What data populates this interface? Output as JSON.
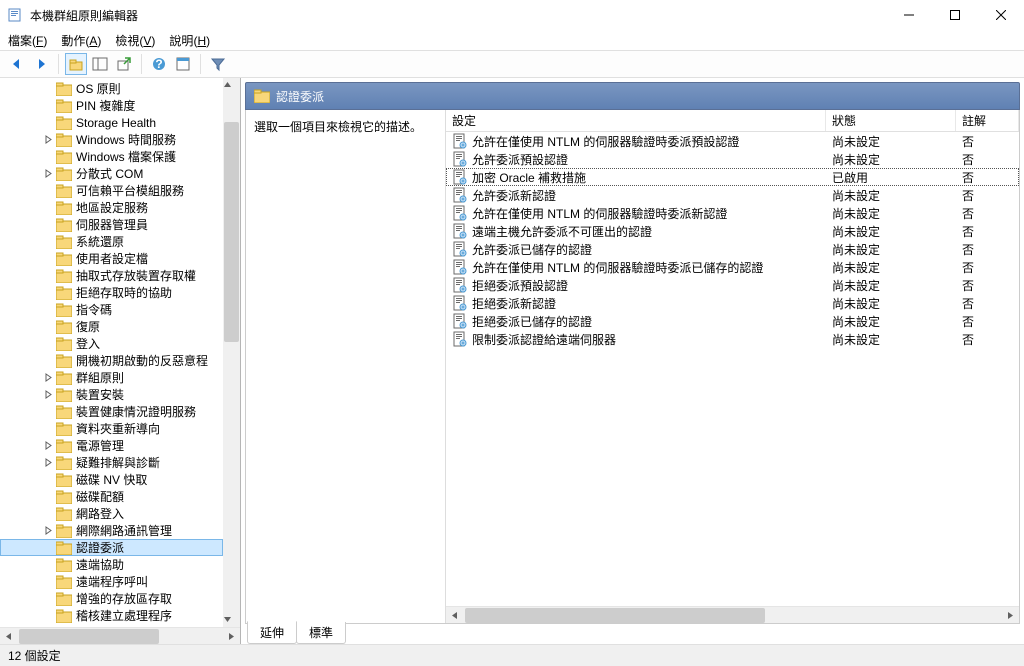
{
  "title": "本機群組原則編輯器",
  "menubar": [
    {
      "label": "檔案",
      "key": "F"
    },
    {
      "label": "動作",
      "key": "A"
    },
    {
      "label": "檢視",
      "key": "V"
    },
    {
      "label": "說明",
      "key": "H"
    }
  ],
  "tree": [
    {
      "label": "OS 原則",
      "exp": null
    },
    {
      "label": "PIN 複雜度",
      "exp": null
    },
    {
      "label": "Storage Health",
      "exp": null
    },
    {
      "label": "Windows 時間服務",
      "exp": true
    },
    {
      "label": "Windows 檔案保護",
      "exp": null
    },
    {
      "label": "分散式 COM",
      "exp": true
    },
    {
      "label": "可信賴平台模組服務",
      "exp": null
    },
    {
      "label": "地區設定服務",
      "exp": null
    },
    {
      "label": "伺服器管理員",
      "exp": null
    },
    {
      "label": "系統還原",
      "exp": null
    },
    {
      "label": "使用者設定檔",
      "exp": null
    },
    {
      "label": "抽取式存放裝置存取權",
      "exp": null
    },
    {
      "label": "拒絕存取時的協助",
      "exp": null
    },
    {
      "label": "指令碼",
      "exp": null
    },
    {
      "label": "復原",
      "exp": null
    },
    {
      "label": "登入",
      "exp": null
    },
    {
      "label": "開機初期啟動的反惡意程",
      "exp": null
    },
    {
      "label": "群組原則",
      "exp": true
    },
    {
      "label": "裝置安裝",
      "exp": true
    },
    {
      "label": "裝置健康情況證明服務",
      "exp": null
    },
    {
      "label": "資料夾重新導向",
      "exp": null
    },
    {
      "label": "電源管理",
      "exp": true
    },
    {
      "label": "疑難排解與診斷",
      "exp": true
    },
    {
      "label": "磁碟 NV 快取",
      "exp": null
    },
    {
      "label": "磁碟配額",
      "exp": null
    },
    {
      "label": "網路登入",
      "exp": null
    },
    {
      "label": "網際網路通訊管理",
      "exp": true
    },
    {
      "label": "認證委派",
      "exp": null,
      "selected": true
    },
    {
      "label": "遠端協助",
      "exp": null
    },
    {
      "label": "遠端程序呼叫",
      "exp": null
    },
    {
      "label": "增強的存放區存取",
      "exp": null
    },
    {
      "label": "稽核建立處理程序",
      "exp": null
    }
  ],
  "right": {
    "header": "認證委派",
    "desc": "選取一個項目來檢視它的描述。",
    "columns": {
      "c1": "設定",
      "c2": "狀態",
      "c3": "註解"
    },
    "rows": [
      {
        "s": "允許在僅使用 NTLM 的伺服器驗證時委派預設認證",
        "st": "尚未設定",
        "c": "否"
      },
      {
        "s": "允許委派預設認證",
        "st": "尚未設定",
        "c": "否"
      },
      {
        "s": "加密 Oracle 補救措施",
        "st": "已啟用",
        "c": "否",
        "sel": true
      },
      {
        "s": "允許委派新認證",
        "st": "尚未設定",
        "c": "否"
      },
      {
        "s": "允許在僅使用 NTLM 的伺服器驗證時委派新認證",
        "st": "尚未設定",
        "c": "否"
      },
      {
        "s": "遠端主機允許委派不可匯出的認證",
        "st": "尚未設定",
        "c": "否"
      },
      {
        "s": "允許委派已儲存的認證",
        "st": "尚未設定",
        "c": "否"
      },
      {
        "s": "允許在僅使用 NTLM 的伺服器驗證時委派已儲存的認證",
        "st": "尚未設定",
        "c": "否"
      },
      {
        "s": "拒絕委派預設認證",
        "st": "尚未設定",
        "c": "否"
      },
      {
        "s": "拒絕委派新認證",
        "st": "尚未設定",
        "c": "否"
      },
      {
        "s": "拒絕委派已儲存的認證",
        "st": "尚未設定",
        "c": "否"
      },
      {
        "s": "限制委派認證給遠端伺服器",
        "st": "尚未設定",
        "c": "否"
      }
    ],
    "tabs": {
      "extended": "延伸",
      "standard": "標準"
    }
  },
  "statusbar": "12 個設定"
}
